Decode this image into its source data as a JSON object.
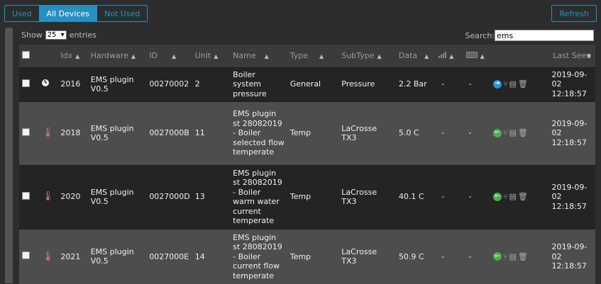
{
  "filters": {
    "used": "Used",
    "all_devices": "All Devices",
    "not_used": "Not Used"
  },
  "refresh_label": "Refresh",
  "show": {
    "prefix": "Show",
    "value": "25",
    "suffix": "entries"
  },
  "search": {
    "label": "Search:",
    "value": "ems"
  },
  "columns": {
    "idx": "Idx",
    "hardware": "Hardware",
    "id": "ID",
    "unit": "Unit",
    "name": "Name",
    "type": "Type",
    "subtype": "SubType",
    "data": "Data",
    "last_seen": "Last Seen"
  },
  "rows": [
    {
      "idx": "2016",
      "hardware": "EMS plugin V0.5",
      "id": "00270002",
      "unit": "2",
      "name": "Boiler system pressure",
      "type": "General",
      "subtype": "Pressure",
      "data": "2.2 Bar",
      "signal": "-",
      "battery": "-",
      "last_seen": "2019-09-02 12:18:57",
      "icon": "gauge-icon",
      "action": "arrow-right"
    },
    {
      "idx": "2018",
      "hardware": "EMS plugin V0.5",
      "id": "0027000B",
      "unit": "11",
      "name": "EMS plugin st 28082019 - Boiler selected flow temperate",
      "type": "Temp",
      "subtype": "LaCrosse TX3",
      "data": "5.0 C",
      "signal": "-",
      "battery": "-",
      "last_seen": "2019-09-02 12:18:57",
      "icon": "thermometer-icon",
      "action": "arrow-left"
    },
    {
      "idx": "2020",
      "hardware": "EMS plugin V0.5",
      "id": "0027000D",
      "unit": "13",
      "name": "EMS plugin st 28082019 - Boiler warm water current temperate",
      "type": "Temp",
      "subtype": "LaCrosse TX3",
      "data": "40.1 C",
      "signal": "-",
      "battery": "-",
      "last_seen": "2019-09-02 12:18:57",
      "icon": "thermometer-icon",
      "action": "arrow-left"
    },
    {
      "idx": "2021",
      "hardware": "EMS plugin V0.5",
      "id": "0027000E",
      "unit": "14",
      "name": "EMS plugin st 28082019 - Boiler current flow temperate",
      "type": "Temp",
      "subtype": "LaCrosse TX3",
      "data": "50.9 C",
      "signal": "-",
      "battery": "-",
      "last_seen": "2019-09-02 12:18:57",
      "icon": "thermometer-icon",
      "action": "arrow-left"
    }
  ]
}
